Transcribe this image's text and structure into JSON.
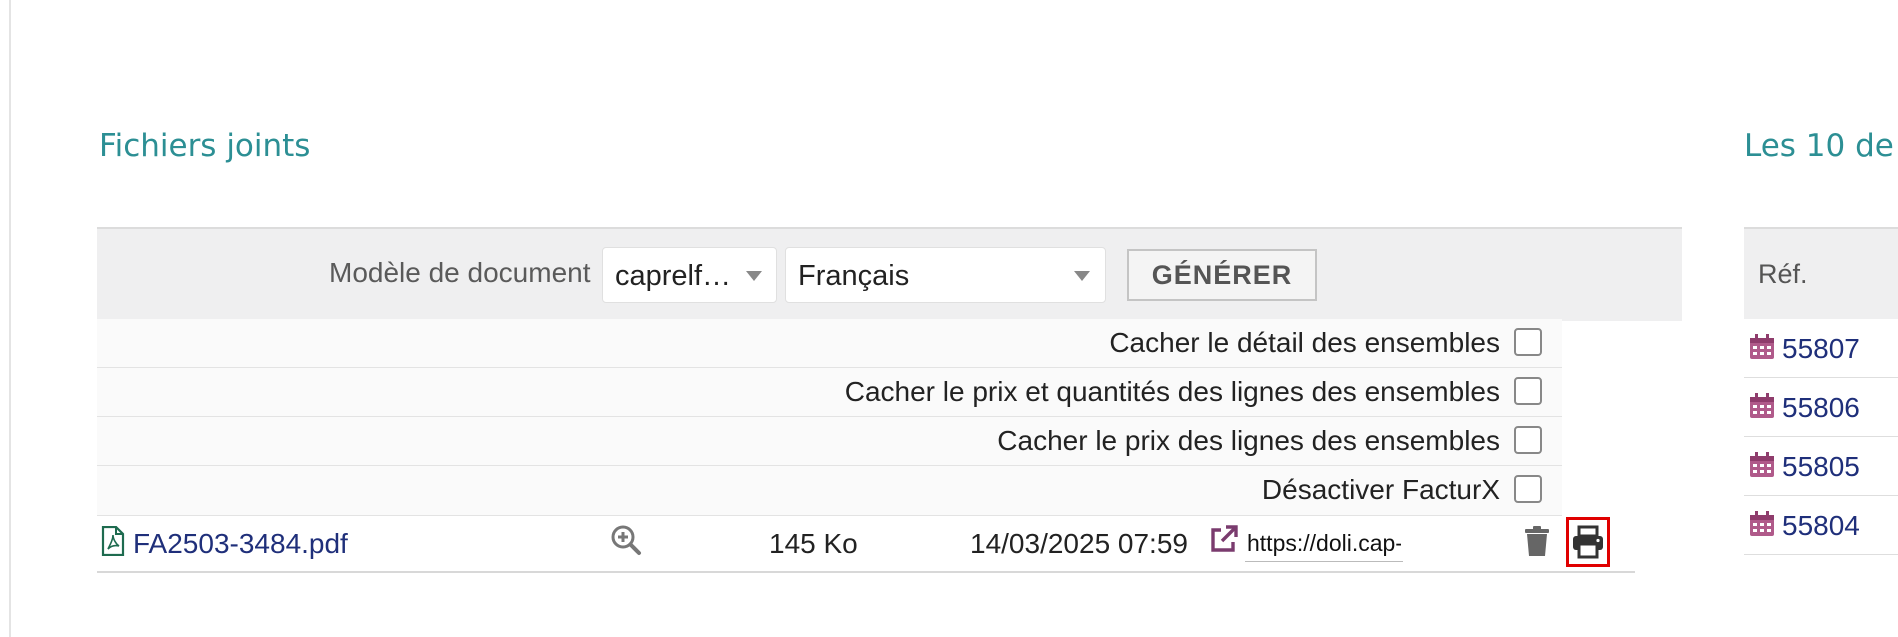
{
  "attachments": {
    "title": "Fichiers joints",
    "generate": {
      "label": "Modèle de document",
      "model_value": "caprelf…",
      "language_value": "Français",
      "button_label": "GÉNÉRER"
    },
    "options": [
      {
        "label": "Cacher le détail des ensembles",
        "checked": false
      },
      {
        "label": "Cacher le prix et quantités des lignes des ensembles",
        "checked": false
      },
      {
        "label": "Cacher le prix des lignes des ensembles",
        "checked": false
      },
      {
        "label": "Désactiver FacturX",
        "checked": false
      }
    ],
    "file": {
      "name": "FA2503-3484.pdf",
      "size": "145 Ko",
      "date": "14/03/2025 07:59",
      "share_url": "https://doli.cap-"
    }
  },
  "recent": {
    "title": "Les 10 de",
    "column_ref": "Réf.",
    "rows": [
      "55807",
      "55806",
      "55805",
      "55804"
    ]
  },
  "colors": {
    "accent_title": "#2c8f94",
    "link": "#1f2f7a",
    "icon_purple": "#7a3b6e",
    "highlight": "#e00000"
  }
}
